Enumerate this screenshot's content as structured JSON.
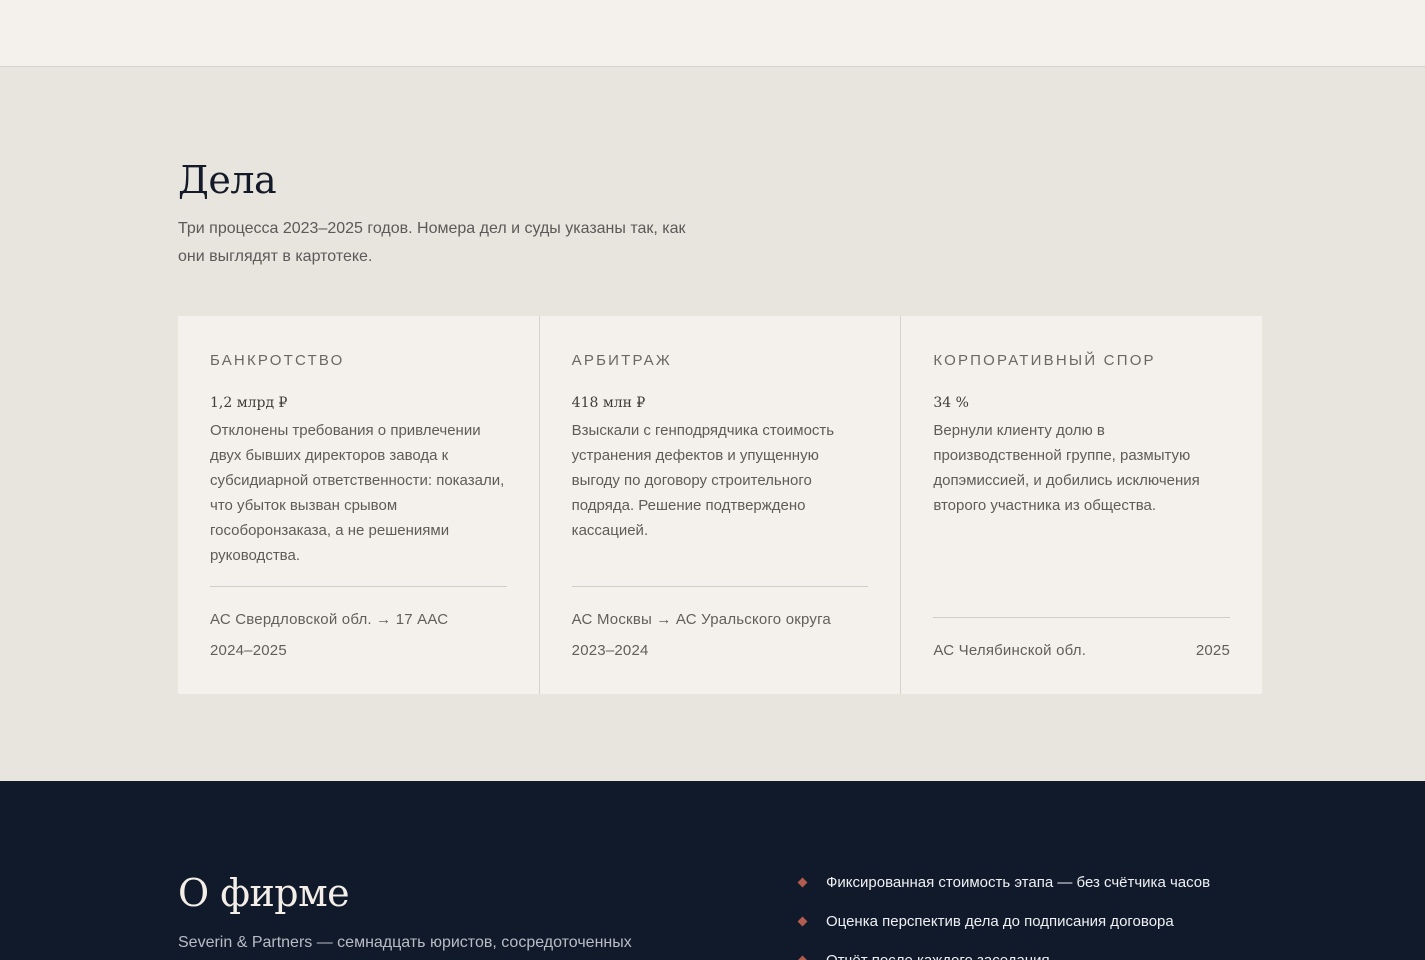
{
  "cases": {
    "title": "Дела",
    "lead": "Три процесса 2023–2025 годов. Номера дел и суды указаны так, как они выглядят в картотеке.",
    "items": [
      {
        "category": "БАНКРОТСТВО",
        "amount": "1,2 млрд ₽",
        "description": "Отклонены требования о привлечении двух бывших директоров завода к субсидиарной ответственности: показали, что убыток вызван срывом гособоронзаказа, а не решениями руководства.",
        "court": "АС Свердловской обл. → 17 ААС",
        "years": "2024–2025"
      },
      {
        "category": "АРБИТРАЖ",
        "amount": "418 млн ₽",
        "description": "Взыскали с генподрядчика стоимость устранения дефектов и упущенную выгоду по договору строительного подряда. Решение подтверждено кассацией.",
        "court": "АС Москвы → АС Уральского округа",
        "years": "2023–2024"
      },
      {
        "category": "КОРПОРАТИВНЫЙ СПОР",
        "amount": "34 %",
        "description": "Вернули клиенту долю в производственной группе, размытую допэмиссией, и добились исключения второго участника из общества.",
        "court": "АС Челябинской обл.",
        "years": "2025"
      }
    ]
  },
  "about": {
    "title": "О фирме",
    "intro": "Severin & Partners — семнадцать юристов, сосредоточенных",
    "points": [
      "Фиксированная стоимость этапа — без счётчика часов",
      "Оценка перспектив дела до подписания договора",
      "Отчёт после каждого заседания"
    ],
    "bullet_color": "#b15c4e"
  }
}
